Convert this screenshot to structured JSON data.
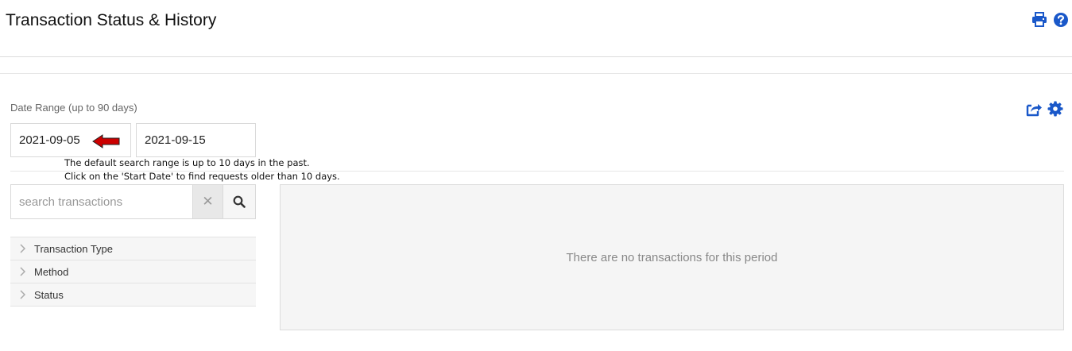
{
  "header": {
    "title": "Transaction Status & History",
    "icons": {
      "print": "print-icon",
      "help": "help-icon"
    },
    "accent_color": "#1a58c9"
  },
  "toolbar": {
    "icons": {
      "export": "export-icon",
      "settings": "gear-icon"
    }
  },
  "date_range": {
    "label": "Date Range (up to 90 days)",
    "start": "2021-09-05",
    "end": "2021-09-15"
  },
  "annotation": {
    "line1": "The default search range is up to 10 days in the past.",
    "line2": "Click on the 'Start Date' to find requests older than 10 days.",
    "arrow_color": "#cc0000"
  },
  "search": {
    "placeholder": "search transactions",
    "value": ""
  },
  "filters": [
    {
      "label": "Transaction Type"
    },
    {
      "label": "Method"
    },
    {
      "label": "Status"
    }
  ],
  "results": {
    "empty_message": "There are no transactions for this period"
  }
}
